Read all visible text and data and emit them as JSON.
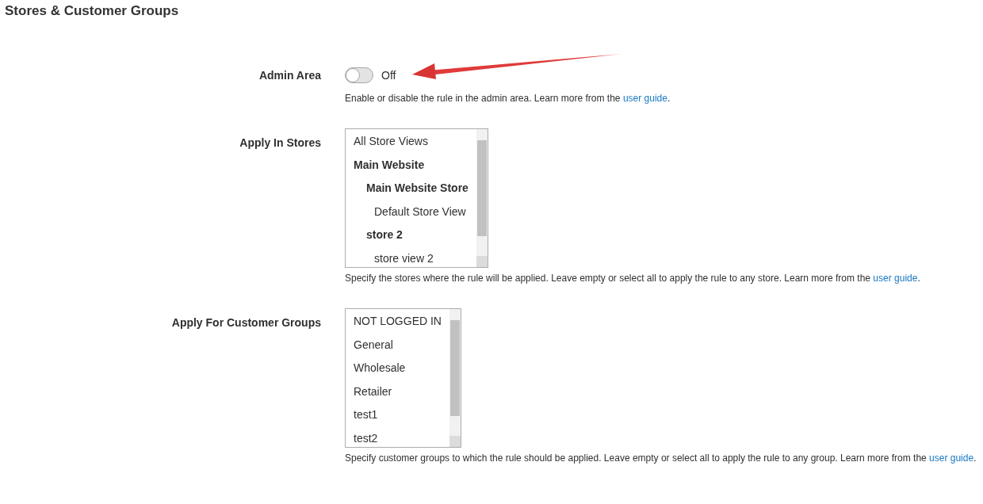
{
  "section_title": "Stores & Customer Groups",
  "fields": [
    {
      "kind": "toggle",
      "label": "Admin Area",
      "on": false,
      "state_text": "Off",
      "note": {
        "text": "Enable or disable the rule in the admin area. Learn more from the ",
        "link": "user guide",
        "after": "."
      }
    },
    {
      "kind": "multiselect",
      "label": "Apply In Stores",
      "options": [
        {
          "label": "All Store Views",
          "kind": "option",
          "selected": false
        },
        {
          "label": "Main Website",
          "kind": "group",
          "children": [
            {
              "label": "Main Website Store",
              "kind": "group",
              "children": [
                {
                  "label": "Default Store View",
                  "kind": "option",
                  "selected": false
                }
              ]
            },
            {
              "label": "store 2",
              "kind": "group",
              "children": [
                {
                  "label": "store view 2",
                  "kind": "option",
                  "selected": false
                }
              ]
            }
          ]
        }
      ],
      "note": {
        "text": "Specify the stores where the rule will be applied. Leave empty or select all to apply the rule to any store. Learn more from the ",
        "link": "user guide",
        "after": "."
      }
    },
    {
      "kind": "multiselect",
      "label": "Apply For Customer Groups",
      "options": [
        {
          "label": "NOT LOGGED IN",
          "kind": "option",
          "selected": false
        },
        {
          "label": "General",
          "kind": "option",
          "selected": false
        },
        {
          "label": "Wholesale",
          "kind": "option",
          "selected": false
        },
        {
          "label": "Retailer",
          "kind": "option",
          "selected": false
        },
        {
          "label": "test1",
          "kind": "option",
          "selected": false
        },
        {
          "label": "test2",
          "kind": "option",
          "selected": false
        }
      ],
      "note": {
        "text": "Specify customer groups to which the rule should be applied. Leave empty or select all to apply the rule to any group. Learn more from the ",
        "link": "user guide",
        "after": "."
      }
    }
  ]
}
